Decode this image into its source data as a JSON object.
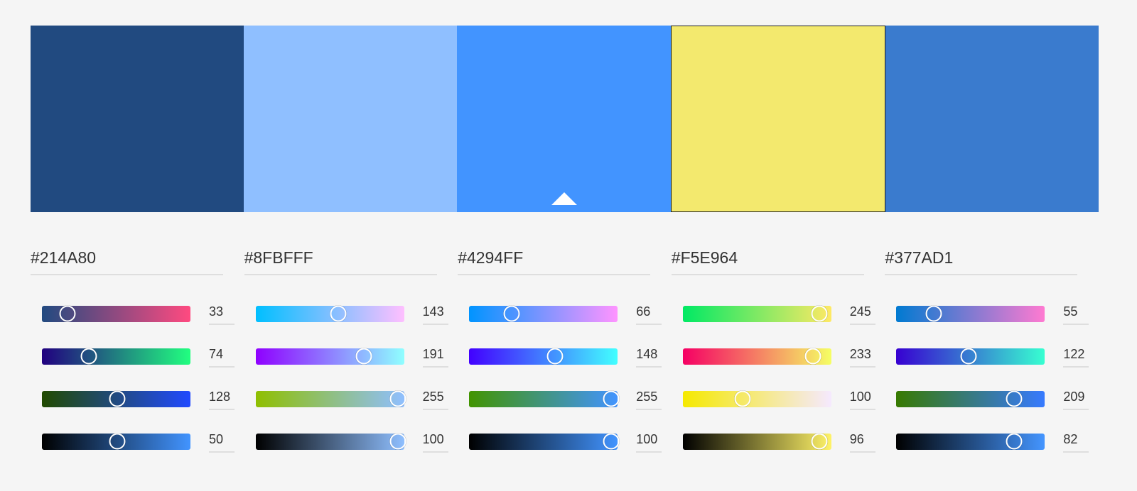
{
  "palette": {
    "active_index": 2,
    "selected_index": 3,
    "colors": [
      {
        "hex": "#214A80",
        "swatch_color": "#214A80",
        "channels": [
          {
            "name": "red-channel",
            "value": 33,
            "fraction": 0.13,
            "gradient": [
              "#214A80",
              "#FF4A80"
            ]
          },
          {
            "name": "green-channel",
            "value": 74,
            "fraction": 0.29,
            "gradient": [
              "#210080",
              "#21FF80"
            ]
          },
          {
            "name": "blue-channel",
            "value": 128,
            "fraction": 0.5,
            "gradient": [
              "#214A00",
              "#214AFF"
            ]
          },
          {
            "name": "brightness-channel",
            "value": 50,
            "fraction": 0.5,
            "gradient": [
              "#000000",
              "#4294FF"
            ]
          }
        ]
      },
      {
        "hex": "#8FBFFF",
        "swatch_color": "#8FBFFF",
        "channels": [
          {
            "name": "red-channel",
            "value": 143,
            "fraction": 0.56,
            "gradient": [
              "#00BFFF",
              "#FFBFFF"
            ]
          },
          {
            "name": "green-channel",
            "value": 191,
            "fraction": 0.75,
            "gradient": [
              "#8F00FF",
              "#8FFFFF"
            ]
          },
          {
            "name": "blue-channel",
            "value": 255,
            "fraction": 1.0,
            "gradient": [
              "#8FBF00",
              "#8FBFFF"
            ]
          },
          {
            "name": "brightness-channel",
            "value": 100,
            "fraction": 1.0,
            "gradient": [
              "#000000",
              "#8FBFFF"
            ]
          }
        ]
      },
      {
        "hex": "#4294FF",
        "swatch_color": "#4294FF",
        "channels": [
          {
            "name": "red-channel",
            "value": 66,
            "fraction": 0.26,
            "gradient": [
              "#0094FF",
              "#FF94FF"
            ]
          },
          {
            "name": "green-channel",
            "value": 148,
            "fraction": 0.58,
            "gradient": [
              "#4200FF",
              "#42FFFF"
            ]
          },
          {
            "name": "blue-channel",
            "value": 255,
            "fraction": 1.0,
            "gradient": [
              "#429400",
              "#4294FF"
            ]
          },
          {
            "name": "brightness-channel",
            "value": 100,
            "fraction": 1.0,
            "gradient": [
              "#000000",
              "#4294FF"
            ]
          }
        ]
      },
      {
        "hex": "#F5E964",
        "swatch_color": "#F3E96E",
        "channels": [
          {
            "name": "red-channel",
            "value": 245,
            "fraction": 0.96,
            "gradient": [
              "#00E964",
              "#FFE964"
            ]
          },
          {
            "name": "green-channel",
            "value": 233,
            "fraction": 0.91,
            "gradient": [
              "#F50064",
              "#F5FF64"
            ]
          },
          {
            "name": "blue-channel",
            "value": 100,
            "fraction": 0.39,
            "gradient": [
              "#F5E900",
              "#F5E9FF"
            ]
          },
          {
            "name": "brightness-channel",
            "value": 96,
            "fraction": 0.96,
            "gradient": [
              "#000000",
              "#FFF368"
            ]
          }
        ]
      },
      {
        "hex": "#377AD1",
        "swatch_color": "#3A7BCE",
        "channels": [
          {
            "name": "red-channel",
            "value": 55,
            "fraction": 0.22,
            "gradient": [
              "#007AD1",
              "#FF7AD1"
            ]
          },
          {
            "name": "green-channel",
            "value": 122,
            "fraction": 0.48,
            "gradient": [
              "#3700D1",
              "#37FFD1"
            ]
          },
          {
            "name": "blue-channel",
            "value": 209,
            "fraction": 0.82,
            "gradient": [
              "#377A00",
              "#377AFF"
            ]
          },
          {
            "name": "brightness-channel",
            "value": 82,
            "fraction": 0.82,
            "gradient": [
              "#000000",
              "#4495FF"
            ]
          }
        ]
      }
    ]
  }
}
